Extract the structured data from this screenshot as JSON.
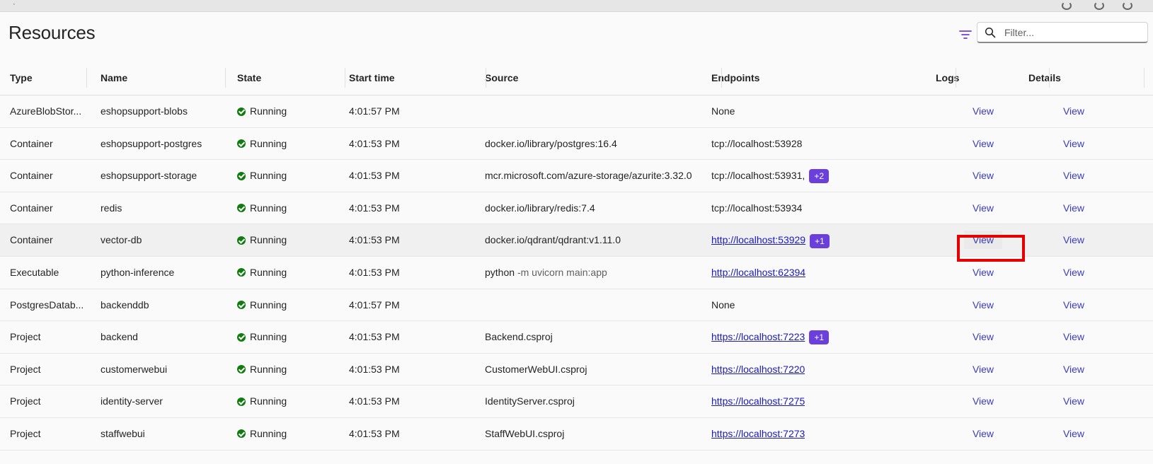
{
  "page": {
    "title": "Resources"
  },
  "search": {
    "placeholder": "Filter..."
  },
  "columns": [
    "Type",
    "Name",
    "State",
    "Start time",
    "Source",
    "Endpoints",
    "Logs",
    "Details"
  ],
  "rows": [
    {
      "type": "AzureBlobStor...",
      "name": "eshopsupport-blobs",
      "state": "Running",
      "start": "4:01:57 PM",
      "source": "",
      "source_args": "",
      "endpoint": "None",
      "endpoint_link": false,
      "badge": "",
      "logs": "View",
      "details": "View"
    },
    {
      "type": "Container",
      "name": "eshopsupport-postgres",
      "state": "Running",
      "start": "4:01:53 PM",
      "source": "docker.io/library/postgres:16.4",
      "source_args": "",
      "endpoint": "tcp://localhost:53928",
      "endpoint_link": false,
      "badge": "",
      "logs": "View",
      "details": "View"
    },
    {
      "type": "Container",
      "name": "eshopsupport-storage",
      "state": "Running",
      "start": "4:01:53 PM",
      "source": "mcr.microsoft.com/azure-storage/azurite:3.32.0",
      "source_args": "",
      "endpoint": "tcp://localhost:53931,",
      "endpoint_link": false,
      "badge": "+2",
      "logs": "View",
      "details": "View"
    },
    {
      "type": "Container",
      "name": "redis",
      "state": "Running",
      "start": "4:01:53 PM",
      "source": "docker.io/library/redis:7.4",
      "source_args": "",
      "endpoint": "tcp://localhost:53934",
      "endpoint_link": false,
      "badge": "",
      "logs": "View",
      "details": "View"
    },
    {
      "type": "Container",
      "name": "vector-db",
      "state": "Running",
      "start": "4:01:53 PM",
      "source": "docker.io/qdrant/qdrant:v1.11.0",
      "source_args": "",
      "endpoint": "http://localhost:53929",
      "endpoint_link": true,
      "badge": "+1",
      "logs": "View",
      "details": "View"
    },
    {
      "type": "Executable",
      "name": "python-inference",
      "state": "Running",
      "start": "4:01:53 PM",
      "source": "python",
      "source_args": "-m uvicorn main:app",
      "endpoint": "http://localhost:62394",
      "endpoint_link": true,
      "badge": "",
      "logs": "View",
      "details": "View"
    },
    {
      "type": "PostgresDatab...",
      "name": "backenddb",
      "state": "Running",
      "start": "4:01:57 PM",
      "source": "",
      "source_args": "",
      "endpoint": "None",
      "endpoint_link": false,
      "badge": "",
      "logs": "View",
      "details": "View"
    },
    {
      "type": "Project",
      "name": "backend",
      "state": "Running",
      "start": "4:01:53 PM",
      "source": "Backend.csproj",
      "source_args": "",
      "endpoint": "https://localhost:7223",
      "endpoint_link": true,
      "badge": "+1",
      "logs": "View",
      "details": "View"
    },
    {
      "type": "Project",
      "name": "customerwebui",
      "state": "Running",
      "start": "4:01:53 PM",
      "source": "CustomerWebUI.csproj",
      "source_args": "",
      "endpoint": "https://localhost:7220",
      "endpoint_link": true,
      "badge": "",
      "logs": "View",
      "details": "View"
    },
    {
      "type": "Project",
      "name": "identity-server",
      "state": "Running",
      "start": "4:01:53 PM",
      "source": "IdentityServer.csproj",
      "source_args": "",
      "endpoint": "https://localhost:7275",
      "endpoint_link": true,
      "badge": "",
      "logs": "View",
      "details": "View"
    },
    {
      "type": "Project",
      "name": "staffwebui",
      "state": "Running",
      "start": "4:01:53 PM",
      "source": "StaffWebUI.csproj",
      "source_args": "",
      "endpoint": "https://localhost:7273",
      "endpoint_link": true,
      "badge": "",
      "logs": "View",
      "details": "View"
    }
  ],
  "selection": {
    "highlighted_row": 4,
    "highlighted_cell": "logs"
  },
  "colors": {
    "running": "#107c10",
    "badge": "#6b3fdb",
    "link": "#1a1ab8",
    "highlight_box": "#e60000"
  },
  "icons": {
    "filter": "filter-icon",
    "search": "search-icon",
    "status": "checkmark-circle-icon"
  }
}
